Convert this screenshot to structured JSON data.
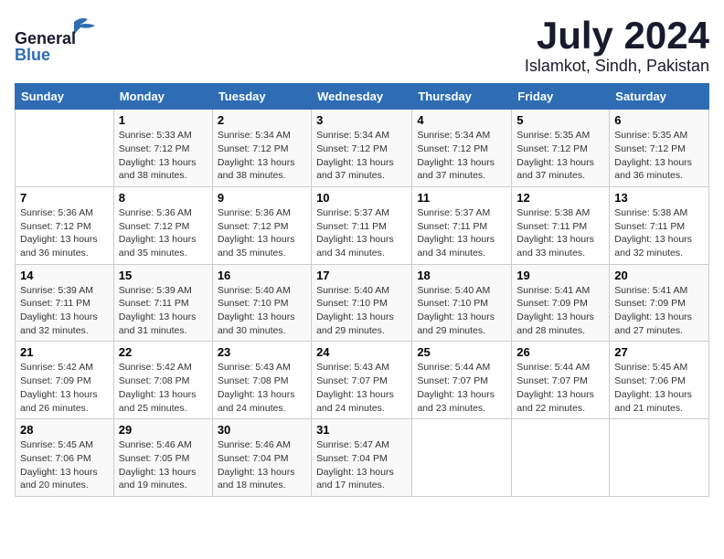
{
  "header": {
    "logo_general": "General",
    "logo_blue": "Blue",
    "month": "July 2024",
    "location": "Islamkot, Sindh, Pakistan"
  },
  "weekdays": [
    "Sunday",
    "Monday",
    "Tuesday",
    "Wednesday",
    "Thursday",
    "Friday",
    "Saturday"
  ],
  "weeks": [
    [
      {
        "day": "",
        "sunrise": "",
        "sunset": "",
        "daylight": ""
      },
      {
        "day": "1",
        "sunrise": "Sunrise: 5:33 AM",
        "sunset": "Sunset: 7:12 PM",
        "daylight": "Daylight: 13 hours and 38 minutes."
      },
      {
        "day": "2",
        "sunrise": "Sunrise: 5:34 AM",
        "sunset": "Sunset: 7:12 PM",
        "daylight": "Daylight: 13 hours and 38 minutes."
      },
      {
        "day": "3",
        "sunrise": "Sunrise: 5:34 AM",
        "sunset": "Sunset: 7:12 PM",
        "daylight": "Daylight: 13 hours and 37 minutes."
      },
      {
        "day": "4",
        "sunrise": "Sunrise: 5:34 AM",
        "sunset": "Sunset: 7:12 PM",
        "daylight": "Daylight: 13 hours and 37 minutes."
      },
      {
        "day": "5",
        "sunrise": "Sunrise: 5:35 AM",
        "sunset": "Sunset: 7:12 PM",
        "daylight": "Daylight: 13 hours and 37 minutes."
      },
      {
        "day": "6",
        "sunrise": "Sunrise: 5:35 AM",
        "sunset": "Sunset: 7:12 PM",
        "daylight": "Daylight: 13 hours and 36 minutes."
      }
    ],
    [
      {
        "day": "7",
        "sunrise": "Sunrise: 5:36 AM",
        "sunset": "Sunset: 7:12 PM",
        "daylight": "Daylight: 13 hours and 36 minutes."
      },
      {
        "day": "8",
        "sunrise": "Sunrise: 5:36 AM",
        "sunset": "Sunset: 7:12 PM",
        "daylight": "Daylight: 13 hours and 35 minutes."
      },
      {
        "day": "9",
        "sunrise": "Sunrise: 5:36 AM",
        "sunset": "Sunset: 7:12 PM",
        "daylight": "Daylight: 13 hours and 35 minutes."
      },
      {
        "day": "10",
        "sunrise": "Sunrise: 5:37 AM",
        "sunset": "Sunset: 7:11 PM",
        "daylight": "Daylight: 13 hours and 34 minutes."
      },
      {
        "day": "11",
        "sunrise": "Sunrise: 5:37 AM",
        "sunset": "Sunset: 7:11 PM",
        "daylight": "Daylight: 13 hours and 34 minutes."
      },
      {
        "day": "12",
        "sunrise": "Sunrise: 5:38 AM",
        "sunset": "Sunset: 7:11 PM",
        "daylight": "Daylight: 13 hours and 33 minutes."
      },
      {
        "day": "13",
        "sunrise": "Sunrise: 5:38 AM",
        "sunset": "Sunset: 7:11 PM",
        "daylight": "Daylight: 13 hours and 32 minutes."
      }
    ],
    [
      {
        "day": "14",
        "sunrise": "Sunrise: 5:39 AM",
        "sunset": "Sunset: 7:11 PM",
        "daylight": "Daylight: 13 hours and 32 minutes."
      },
      {
        "day": "15",
        "sunrise": "Sunrise: 5:39 AM",
        "sunset": "Sunset: 7:11 PM",
        "daylight": "Daylight: 13 hours and 31 minutes."
      },
      {
        "day": "16",
        "sunrise": "Sunrise: 5:40 AM",
        "sunset": "Sunset: 7:10 PM",
        "daylight": "Daylight: 13 hours and 30 minutes."
      },
      {
        "day": "17",
        "sunrise": "Sunrise: 5:40 AM",
        "sunset": "Sunset: 7:10 PM",
        "daylight": "Daylight: 13 hours and 29 minutes."
      },
      {
        "day": "18",
        "sunrise": "Sunrise: 5:40 AM",
        "sunset": "Sunset: 7:10 PM",
        "daylight": "Daylight: 13 hours and 29 minutes."
      },
      {
        "day": "19",
        "sunrise": "Sunrise: 5:41 AM",
        "sunset": "Sunset: 7:09 PM",
        "daylight": "Daylight: 13 hours and 28 minutes."
      },
      {
        "day": "20",
        "sunrise": "Sunrise: 5:41 AM",
        "sunset": "Sunset: 7:09 PM",
        "daylight": "Daylight: 13 hours and 27 minutes."
      }
    ],
    [
      {
        "day": "21",
        "sunrise": "Sunrise: 5:42 AM",
        "sunset": "Sunset: 7:09 PM",
        "daylight": "Daylight: 13 hours and 26 minutes."
      },
      {
        "day": "22",
        "sunrise": "Sunrise: 5:42 AM",
        "sunset": "Sunset: 7:08 PM",
        "daylight": "Daylight: 13 hours and 25 minutes."
      },
      {
        "day": "23",
        "sunrise": "Sunrise: 5:43 AM",
        "sunset": "Sunset: 7:08 PM",
        "daylight": "Daylight: 13 hours and 24 minutes."
      },
      {
        "day": "24",
        "sunrise": "Sunrise: 5:43 AM",
        "sunset": "Sunset: 7:07 PM",
        "daylight": "Daylight: 13 hours and 24 minutes."
      },
      {
        "day": "25",
        "sunrise": "Sunrise: 5:44 AM",
        "sunset": "Sunset: 7:07 PM",
        "daylight": "Daylight: 13 hours and 23 minutes."
      },
      {
        "day": "26",
        "sunrise": "Sunrise: 5:44 AM",
        "sunset": "Sunset: 7:07 PM",
        "daylight": "Daylight: 13 hours and 22 minutes."
      },
      {
        "day": "27",
        "sunrise": "Sunrise: 5:45 AM",
        "sunset": "Sunset: 7:06 PM",
        "daylight": "Daylight: 13 hours and 21 minutes."
      }
    ],
    [
      {
        "day": "28",
        "sunrise": "Sunrise: 5:45 AM",
        "sunset": "Sunset: 7:06 PM",
        "daylight": "Daylight: 13 hours and 20 minutes."
      },
      {
        "day": "29",
        "sunrise": "Sunrise: 5:46 AM",
        "sunset": "Sunset: 7:05 PM",
        "daylight": "Daylight: 13 hours and 19 minutes."
      },
      {
        "day": "30",
        "sunrise": "Sunrise: 5:46 AM",
        "sunset": "Sunset: 7:04 PM",
        "daylight": "Daylight: 13 hours and 18 minutes."
      },
      {
        "day": "31",
        "sunrise": "Sunrise: 5:47 AM",
        "sunset": "Sunset: 7:04 PM",
        "daylight": "Daylight: 13 hours and 17 minutes."
      },
      {
        "day": "",
        "sunrise": "",
        "sunset": "",
        "daylight": ""
      },
      {
        "day": "",
        "sunrise": "",
        "sunset": "",
        "daylight": ""
      },
      {
        "day": "",
        "sunrise": "",
        "sunset": "",
        "daylight": ""
      }
    ]
  ]
}
